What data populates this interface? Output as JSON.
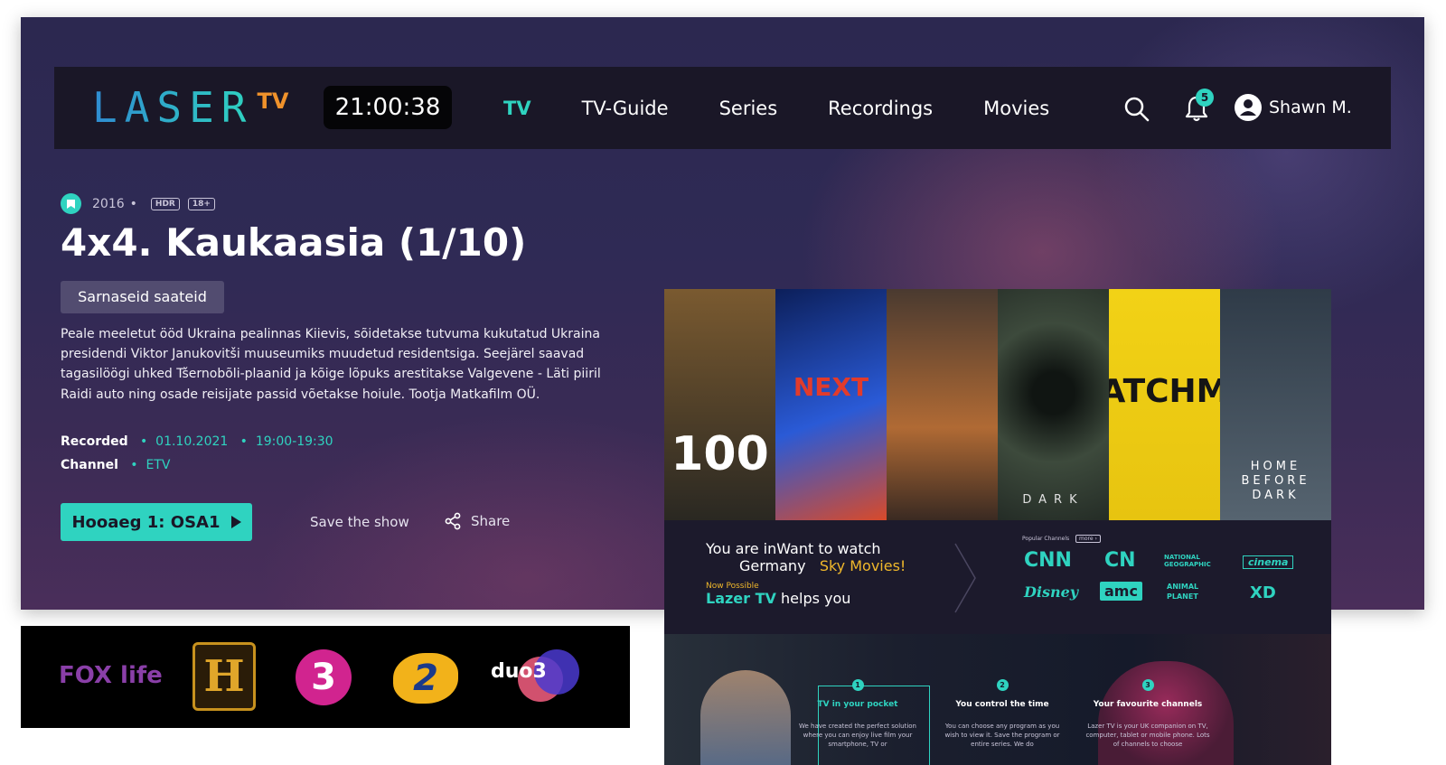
{
  "app": {
    "logo_text": "LASER",
    "logo_tv": "TV",
    "clock": "21:00:38"
  },
  "nav": {
    "items": [
      {
        "label": "TV",
        "active": true
      },
      {
        "label": "TV-Guide",
        "active": false
      },
      {
        "label": "Series",
        "active": false
      },
      {
        "label": "Recordings",
        "active": false
      },
      {
        "label": "Movies",
        "active": false
      }
    ],
    "notification_count": "5",
    "user_name": "Shawn M."
  },
  "show": {
    "year": "2016",
    "badges": [
      "HDR",
      "18+"
    ],
    "title": "4x4. Kaukaasia (1/10)",
    "similar_label": "Sarnaseid saateid",
    "description": "Peale meeletut ööd Ukraina pealinnas Kiievis, sõidetakse tutvuma kukutatud Ukraina presidendi Viktor Janukovitši muuseumiks muudetud residentsiga. Seejärel saavad tagasilöögi uhked Tšernobõli-plaanid ja kõige lõpuks arestitakse Valgevene - Läti piiril Raidi auto ning osade reisijate passid võetakse hoiule. Tootja Matkafilm OÜ.",
    "recorded_label": "Recorded",
    "recorded_date": "01.10.2021",
    "recorded_time": "19:00-19:30",
    "channel_label": "Channel",
    "channel_value": "ETV",
    "play_label": "Hooaeg 1: OSA1",
    "save_label": "Save the show",
    "share_label": "Share"
  },
  "strip_channels": [
    "FOX life",
    "H",
    "3",
    "2",
    "duo3"
  ],
  "showcase": {
    "posters": [
      {
        "text": "100",
        "bg": "#3a3028",
        "color": "#ffffff"
      },
      {
        "text": "NEXT",
        "bg": "#1b3f9a",
        "color": "#e23b2b"
      },
      {
        "text": "",
        "bg": "#7a4a2a",
        "color": "#ffffff"
      },
      {
        "text": "DARK",
        "bg": "#3a4438",
        "color": "#e0e0e0"
      },
      {
        "text": "ATCHM",
        "bg": "#f2d216",
        "color": "#1a1a1a"
      },
      {
        "text": "HOME BEFORE DARK",
        "bg": "#3d4a55",
        "color": "#ffffff"
      }
    ],
    "promo_line1": "You are inWant to watch",
    "promo_line2a": "Germany",
    "promo_line2b": "Sky Movies!",
    "now_possible": "Now Possible",
    "promo_brand": "Lazer TV",
    "promo_helps": "helps you",
    "popular_label": "Popular Channels",
    "more_label": "more ›",
    "channel_logos": [
      "CNN",
      "CN",
      "NATIONAL GEOGRAPHIC",
      "cinema",
      "Disney",
      "amc",
      "ANIMAL PLANET",
      "XD"
    ],
    "features": [
      {
        "num": "1",
        "title": "TV in your pocket",
        "text": "We have created the perfect solution where you can enjoy live film your smartphone, TV or"
      },
      {
        "num": "2",
        "title": "You control the time",
        "text": "You can choose any program as you wish to view it. Save the program or entire series. We do"
      },
      {
        "num": "3",
        "title": "Your favourite channels",
        "text": "Lazer TV is your UK companion on TV, computer, tablet or mobile phone. Lots of channels to choose"
      }
    ]
  },
  "colors": {
    "accent": "#2fd3c0",
    "orange": "#f0922b",
    "nav_bg": "#1a1727"
  }
}
